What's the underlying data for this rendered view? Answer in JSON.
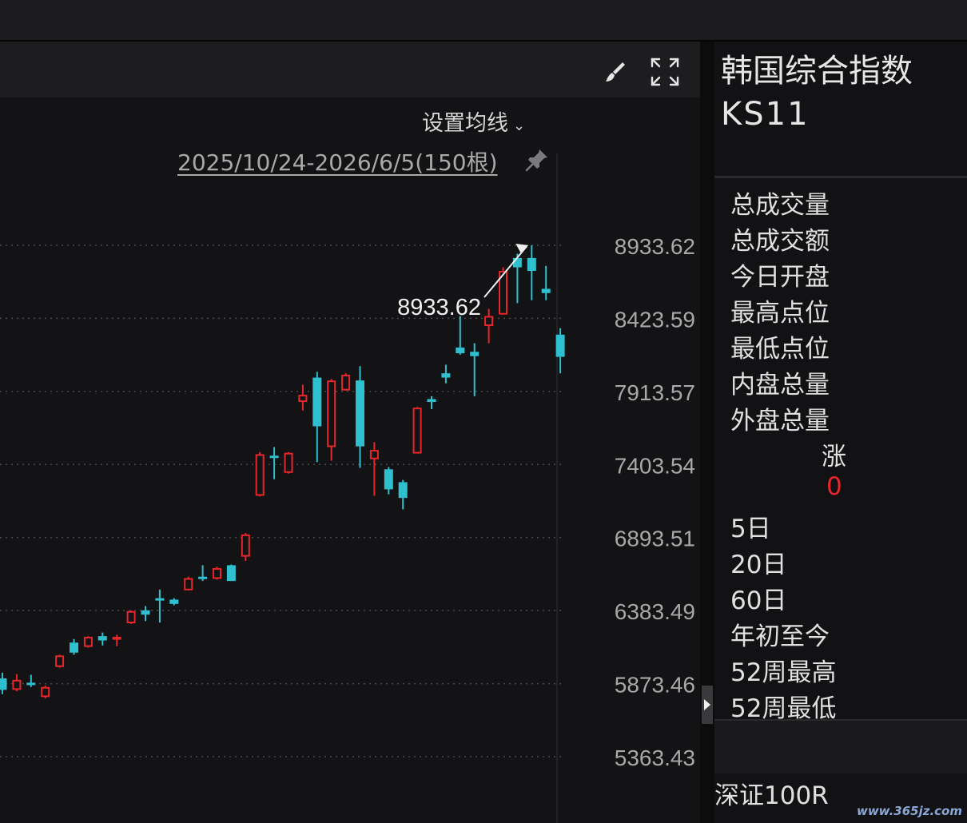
{
  "chart_panel": {
    "ma_setting_label": "设置均线",
    "range_label": "2025/10/24-2026/6/5(150根)"
  },
  "icons": {
    "brush": "brush-icon",
    "expand": "fullscreen-icon",
    "pin": "pin-icon",
    "ma_chevron": "chevron-down-icon",
    "splitter": "triangle-right-icon"
  },
  "colors": {
    "up": "#e8262a",
    "down": "#2fc0cf",
    "grid": "#4a4a4e",
    "axis_text": "#a8a8a8",
    "annotation": "#f0f0f0"
  },
  "chart_data": {
    "type": "candlestick",
    "y_ticks": [
      "8933.62",
      "8423.59",
      "7913.57",
      "7403.54",
      "6893.51",
      "6383.49",
      "5873.46",
      "5363.43"
    ],
    "ylim": [
      5363.43,
      8933.62
    ],
    "grid": "horizontal-dotted",
    "annotation": {
      "label": "8933.62",
      "value": 8933.62,
      "candle_index": 37
    },
    "candles": [
      {
        "o": 5910,
        "c": 5830,
        "h": 5950,
        "l": 5800
      },
      {
        "o": 5830,
        "c": 5900,
        "h": 5940,
        "l": 5820
      },
      {
        "o": 5880,
        "c": 5875,
        "h": 5935,
        "l": 5850
      },
      {
        "o": 5780,
        "c": 5850,
        "h": 5860,
        "l": 5770
      },
      {
        "o": 5990,
        "c": 6070,
        "h": 6075,
        "l": 5985
      },
      {
        "o": 6160,
        "c": 6090,
        "h": 6185,
        "l": 6075
      },
      {
        "o": 6130,
        "c": 6200,
        "h": 6205,
        "l": 6125
      },
      {
        "o": 6205,
        "c": 6175,
        "h": 6230,
        "l": 6140
      },
      {
        "o": 6180,
        "c": 6200,
        "h": 6215,
        "l": 6135
      },
      {
        "o": 6295,
        "c": 6380,
        "h": 6385,
        "l": 6290
      },
      {
        "o": 6385,
        "c": 6355,
        "h": 6415,
        "l": 6310
      },
      {
        "o": 6470,
        "c": 6460,
        "h": 6530,
        "l": 6300
      },
      {
        "o": 6460,
        "c": 6430,
        "h": 6470,
        "l": 6420
      },
      {
        "o": 6525,
        "c": 6610,
        "h": 6620,
        "l": 6525
      },
      {
        "o": 6620,
        "c": 6610,
        "h": 6700,
        "l": 6590
      },
      {
        "o": 6605,
        "c": 6680,
        "h": 6690,
        "l": 6600
      },
      {
        "o": 6700,
        "c": 6590,
        "h": 6705,
        "l": 6590
      },
      {
        "o": 6760,
        "c": 6915,
        "h": 6925,
        "l": 6730
      },
      {
        "o": 7185,
        "c": 7475,
        "h": 7490,
        "l": 7180
      },
      {
        "o": 7465,
        "c": 7460,
        "h": 7525,
        "l": 7300
      },
      {
        "o": 7345,
        "c": 7485,
        "h": 7490,
        "l": 7340
      },
      {
        "o": 7840,
        "c": 7890,
        "h": 7960,
        "l": 7780
      },
      {
        "o": 8010,
        "c": 7670,
        "h": 8050,
        "l": 7420
      },
      {
        "o": 7525,
        "c": 7990,
        "h": 8000,
        "l": 7430
      },
      {
        "o": 7920,
        "c": 8030,
        "h": 8040,
        "l": 7920
      },
      {
        "o": 7990,
        "c": 7530,
        "h": 8090,
        "l": 7380
      },
      {
        "o": 7440,
        "c": 7505,
        "h": 7560,
        "l": 7185
      },
      {
        "o": 7370,
        "c": 7230,
        "h": 7385,
        "l": 7195
      },
      {
        "o": 7280,
        "c": 7170,
        "h": 7295,
        "l": 7090
      },
      {
        "o": 7480,
        "c": 7800,
        "h": 7805,
        "l": 7480
      },
      {
        "o": 7860,
        "c": 7840,
        "h": 7880,
        "l": 7790
      },
      {
        "o": 8040,
        "c": 8010,
        "h": 8100,
        "l": 7970
      },
      {
        "o": 8220,
        "c": 8180,
        "h": 8440,
        "l": 8170
      },
      {
        "o": 8190,
        "c": 8160,
        "h": 8250,
        "l": 7880
      },
      {
        "o": 8370,
        "c": 8440,
        "h": 8490,
        "l": 8250
      },
      {
        "o": 8450,
        "c": 8755,
        "h": 8780,
        "l": 8450
      },
      {
        "o": 8845,
        "c": 8780,
        "h": 8875,
        "l": 8530
      },
      {
        "o": 8845,
        "c": 8755,
        "h": 8933.62,
        "l": 8550
      },
      {
        "o": 8630,
        "c": 8600,
        "h": 8790,
        "l": 8550
      },
      {
        "o": 8310,
        "c": 8155,
        "h": 8355,
        "l": 8040
      }
    ]
  },
  "side_panel": {
    "title_cn": "韩国综合指数",
    "title_code": "KS11",
    "stats": [
      "总成交量",
      "总成交额",
      "今日开盘",
      "最高点位",
      "最低点位",
      "内盘总量",
      "外盘总量"
    ],
    "change_label": "涨",
    "change_value": "0",
    "periods": [
      "5日",
      "20日",
      "60日",
      "年初至今",
      "52周最高",
      "52周最低"
    ],
    "footer_item": "深证100R"
  },
  "watermark": "www.365jz.com"
}
